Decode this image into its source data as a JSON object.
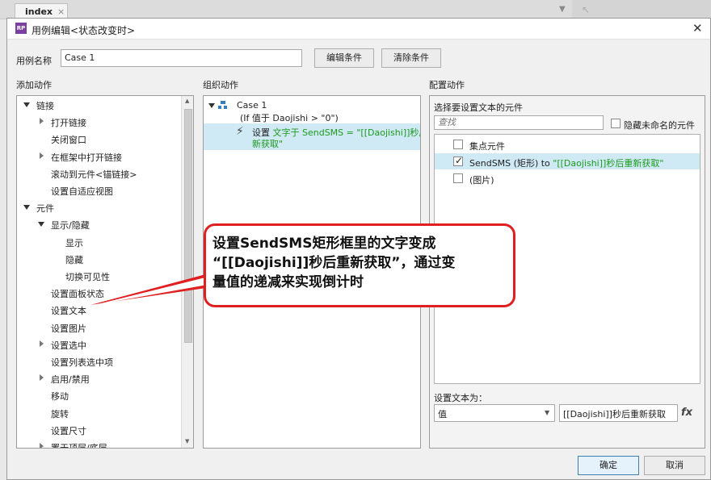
{
  "background_app": {
    "tab_label": "index",
    "tab_close": "×",
    "strip_chevron": "▼",
    "strip_icon": "↖"
  },
  "dialog": {
    "title": "用例编辑<状态改变时>",
    "app_icon_text": "RP",
    "close_glyph": "✕",
    "case_name_label": "用例名称",
    "case_name_value": "Case 1",
    "edit_condition_button": "编辑条件",
    "clear_condition_button": "清除条件"
  },
  "add_actions": {
    "header": "添加动作",
    "items": [
      {
        "label": "链接",
        "level": 0,
        "expand": "down"
      },
      {
        "label": "打开链接",
        "level": 1,
        "expand": "right"
      },
      {
        "label": "关闭窗口",
        "level": 1,
        "expand": "none"
      },
      {
        "label": "在框架中打开链接",
        "level": 1,
        "expand": "right"
      },
      {
        "label": "滚动到元件<锚链接>",
        "level": 1,
        "expand": "none"
      },
      {
        "label": "设置自适应视图",
        "level": 1,
        "expand": "none"
      },
      {
        "label": "元件",
        "level": 0,
        "expand": "down"
      },
      {
        "label": "显示/隐藏",
        "level": 1,
        "expand": "down"
      },
      {
        "label": "显示",
        "level": 2,
        "expand": "none"
      },
      {
        "label": "隐藏",
        "level": 2,
        "expand": "none"
      },
      {
        "label": "切换可见性",
        "level": 2,
        "expand": "none"
      },
      {
        "label": "设置面板状态",
        "level": 1,
        "expand": "none"
      },
      {
        "label": "设置文本",
        "level": 1,
        "expand": "none"
      },
      {
        "label": "设置图片",
        "level": 1,
        "expand": "none"
      },
      {
        "label": "设置选中",
        "level": 1,
        "expand": "right"
      },
      {
        "label": "设置列表选中项",
        "level": 1,
        "expand": "none"
      },
      {
        "label": "启用/禁用",
        "level": 1,
        "expand": "right"
      },
      {
        "label": "移动",
        "level": 1,
        "expand": "none"
      },
      {
        "label": "旋转",
        "level": 1,
        "expand": "none"
      },
      {
        "label": "设置尺寸",
        "level": 1,
        "expand": "none"
      },
      {
        "label": "置于顶层/底层",
        "level": 1,
        "expand": "right"
      }
    ]
  },
  "organize_actions": {
    "header": "组织动作",
    "case_label": "Case 1",
    "case_condition": "(If 值于 Daojishi > \"0\")",
    "action_prefix": "设置 ",
    "action_green_1": "文字于 SendSMS = \"[[Daojishi]]秒后重",
    "action_green_2": "新获取\""
  },
  "configure_actions": {
    "header": "配置动作",
    "select_widget_label": "选择要设置文本的元件",
    "search_placeholder": "查找",
    "hide_unnamed_label": "隐藏未命名的元件",
    "widgets": [
      {
        "label": "集点元件",
        "checked": false,
        "selected": false
      },
      {
        "label": "SendSMS (矩形) to ",
        "value": "\"[[Daojishi]]秒后重新获取\"",
        "checked": true,
        "selected": true
      },
      {
        "label": "(图片)",
        "checked": false,
        "selected": false
      }
    ],
    "set_text_label": "设置文本为：",
    "type_select_value": "值",
    "text_value": "[[Daojishi]]秒后重新获取",
    "fx_label": "fx"
  },
  "annotation": {
    "line1": "设置SendSMS矩形框里的文字变成",
    "line2": "“[[Daojishi]]秒后重新获取”，通过变",
    "line3": "量值的递减来实现倒计时",
    "color": "#e02020"
  },
  "footer": {
    "ok_button": "确定",
    "cancel_button": "取消"
  }
}
